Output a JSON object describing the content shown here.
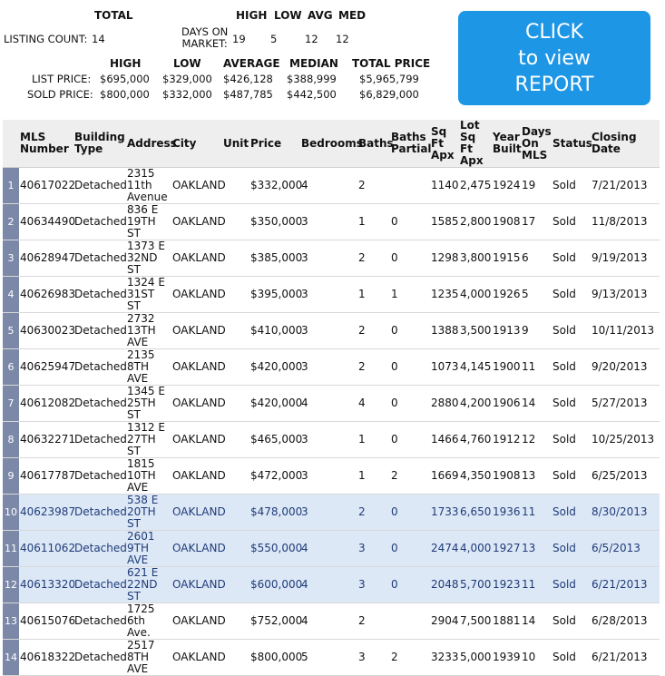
{
  "summary": {
    "total_label": "TOTAL",
    "high_label": "HIGH",
    "low_label": "LOW",
    "avg_label": "AVG",
    "med_label": "MED",
    "listing_count_label": "LISTING COUNT:",
    "listing_count": "14",
    "dom_label_1": "DAYS ON",
    "dom_label_2": "MARKET:",
    "dom_high": "19",
    "dom_low": "5",
    "dom_avg": "12",
    "dom_med": "12"
  },
  "prices": {
    "headers": [
      "HIGH",
      "LOW",
      "AVERAGE",
      "MEDIAN",
      "TOTAL PRICE"
    ],
    "list_label": "LIST PRICE:",
    "sold_label": "SOLD PRICE:",
    "list": [
      "$695,000",
      "$329,000",
      "$426,128",
      "$388,999",
      "$5,965,799"
    ],
    "sold": [
      "$800,000",
      "$332,000",
      "$487,785",
      "$442,500",
      "$6,829,000"
    ]
  },
  "report_button": {
    "line1": "CLICK",
    "line2": "to view",
    "line3": "REPORT",
    "color": "#1e96e6"
  },
  "table": {
    "columns": [
      "",
      "MLS Number",
      "Building Type",
      "Address",
      "City",
      "Unit",
      "Price",
      "Bedrooms",
      "Baths",
      "Baths Partial",
      "Sq Ft Apx",
      "Lot Sq Ft Apx",
      "Year Built",
      "Days On MLS",
      "Status",
      "Closing Date"
    ],
    "rows": [
      {
        "n": "1",
        "mls": "40617022",
        "type": "Detached",
        "addr": "2315 11th Avenue",
        "city": "OAKLAND",
        "unit": "",
        "price": "$332,000",
        "bed": "4",
        "bath": "2",
        "bp": "",
        "sqft": "1140",
        "lot": "2,475",
        "year": "1924",
        "dom": "19",
        "status": "Sold",
        "close": "7/21/2013"
      },
      {
        "n": "2",
        "mls": "40634490",
        "type": "Detached",
        "addr": "836 E 19TH ST",
        "city": "OAKLAND",
        "unit": "",
        "price": "$350,000",
        "bed": "3",
        "bath": "1",
        "bp": "0",
        "sqft": "1585",
        "lot": "2,800",
        "year": "1908",
        "dom": "17",
        "status": "Sold",
        "close": "11/8/2013"
      },
      {
        "n": "3",
        "mls": "40628947",
        "type": "Detached",
        "addr": "1373 E 32ND ST",
        "city": "OAKLAND",
        "unit": "",
        "price": "$385,000",
        "bed": "3",
        "bath": "2",
        "bp": "0",
        "sqft": "1298",
        "lot": "3,800",
        "year": "1915",
        "dom": "6",
        "status": "Sold",
        "close": "9/19/2013"
      },
      {
        "n": "4",
        "mls": "40626983",
        "type": "Detached",
        "addr": "1324 E 31ST ST",
        "city": "OAKLAND",
        "unit": "",
        "price": "$395,000",
        "bed": "3",
        "bath": "1",
        "bp": "1",
        "sqft": "1235",
        "lot": "4,000",
        "year": "1926",
        "dom": "5",
        "status": "Sold",
        "close": "9/13/2013"
      },
      {
        "n": "5",
        "mls": "40630023",
        "type": "Detached",
        "addr": "2732 13TH AVE",
        "city": "OAKLAND",
        "unit": "",
        "price": "$410,000",
        "bed": "3",
        "bath": "2",
        "bp": "0",
        "sqft": "1388",
        "lot": "3,500",
        "year": "1913",
        "dom": "9",
        "status": "Sold",
        "close": "10/11/2013"
      },
      {
        "n": "6",
        "mls": "40625947",
        "type": "Detached",
        "addr": "2135 8TH AVE",
        "city": "OAKLAND",
        "unit": "",
        "price": "$420,000",
        "bed": "3",
        "bath": "2",
        "bp": "0",
        "sqft": "1073",
        "lot": "4,145",
        "year": "1900",
        "dom": "11",
        "status": "Sold",
        "close": "9/20/2013"
      },
      {
        "n": "7",
        "mls": "40612082",
        "type": "Detached",
        "addr": "1345 E 25TH ST",
        "city": "OAKLAND",
        "unit": "",
        "price": "$420,000",
        "bed": "4",
        "bath": "4",
        "bp": "0",
        "sqft": "2880",
        "lot": "4,200",
        "year": "1906",
        "dom": "14",
        "status": "Sold",
        "close": "5/27/2013"
      },
      {
        "n": "8",
        "mls": "40632271",
        "type": "Detached",
        "addr": "1312 E 27TH ST",
        "city": "OAKLAND",
        "unit": "",
        "price": "$465,000",
        "bed": "3",
        "bath": "1",
        "bp": "0",
        "sqft": "1466",
        "lot": "4,760",
        "year": "1912",
        "dom": "12",
        "status": "Sold",
        "close": "10/25/2013"
      },
      {
        "n": "9",
        "mls": "40617787",
        "type": "Detached",
        "addr": "1815 10TH AVE",
        "city": "OAKLAND",
        "unit": "",
        "price": "$472,000",
        "bed": "3",
        "bath": "1",
        "bp": "2",
        "sqft": "1669",
        "lot": "4,350",
        "year": "1908",
        "dom": "13",
        "status": "Sold",
        "close": "6/25/2013"
      },
      {
        "n": "10",
        "mls": "40623987",
        "type": "Detached",
        "addr": "538 E 20TH ST",
        "city": "OAKLAND",
        "unit": "",
        "price": "$478,000",
        "bed": "3",
        "bath": "2",
        "bp": "0",
        "sqft": "1733",
        "lot": "6,650",
        "year": "1936",
        "dom": "11",
        "status": "Sold",
        "close": "8/30/2013",
        "hl": true
      },
      {
        "n": "11",
        "mls": "40611062",
        "type": "Detached",
        "addr": "2601 9TH AVE",
        "city": "OAKLAND",
        "unit": "",
        "price": "$550,000",
        "bed": "4",
        "bath": "3",
        "bp": "0",
        "sqft": "2474",
        "lot": "4,000",
        "year": "1927",
        "dom": "13",
        "status": "Sold",
        "close": "6/5/2013",
        "hl": true
      },
      {
        "n": "12",
        "mls": "40613320",
        "type": "Detached",
        "addr": "621 E 22ND ST",
        "city": "OAKLAND",
        "unit": "",
        "price": "$600,000",
        "bed": "4",
        "bath": "3",
        "bp": "0",
        "sqft": "2048",
        "lot": "5,700",
        "year": "1923",
        "dom": "11",
        "status": "Sold",
        "close": "6/21/2013",
        "hl": true
      },
      {
        "n": "13",
        "mls": "40615076",
        "type": "Detached",
        "addr": "1725 6th Ave.",
        "city": "OAKLAND",
        "unit": "",
        "price": "$752,000",
        "bed": "4",
        "bath": "2",
        "bp": "",
        "sqft": "2904",
        "lot": "7,500",
        "year": "1881",
        "dom": "14",
        "status": "Sold",
        "close": "6/28/2013"
      },
      {
        "n": "14",
        "mls": "40618322",
        "type": "Detached",
        "addr": "2517 8TH AVE",
        "city": "OAKLAND",
        "unit": "",
        "price": "$800,000",
        "bed": "5",
        "bath": "3",
        "bp": "2",
        "sqft": "3233",
        "lot": "5,000",
        "year": "1939",
        "dom": "10",
        "status": "Sold",
        "close": "6/21/2013"
      }
    ]
  }
}
